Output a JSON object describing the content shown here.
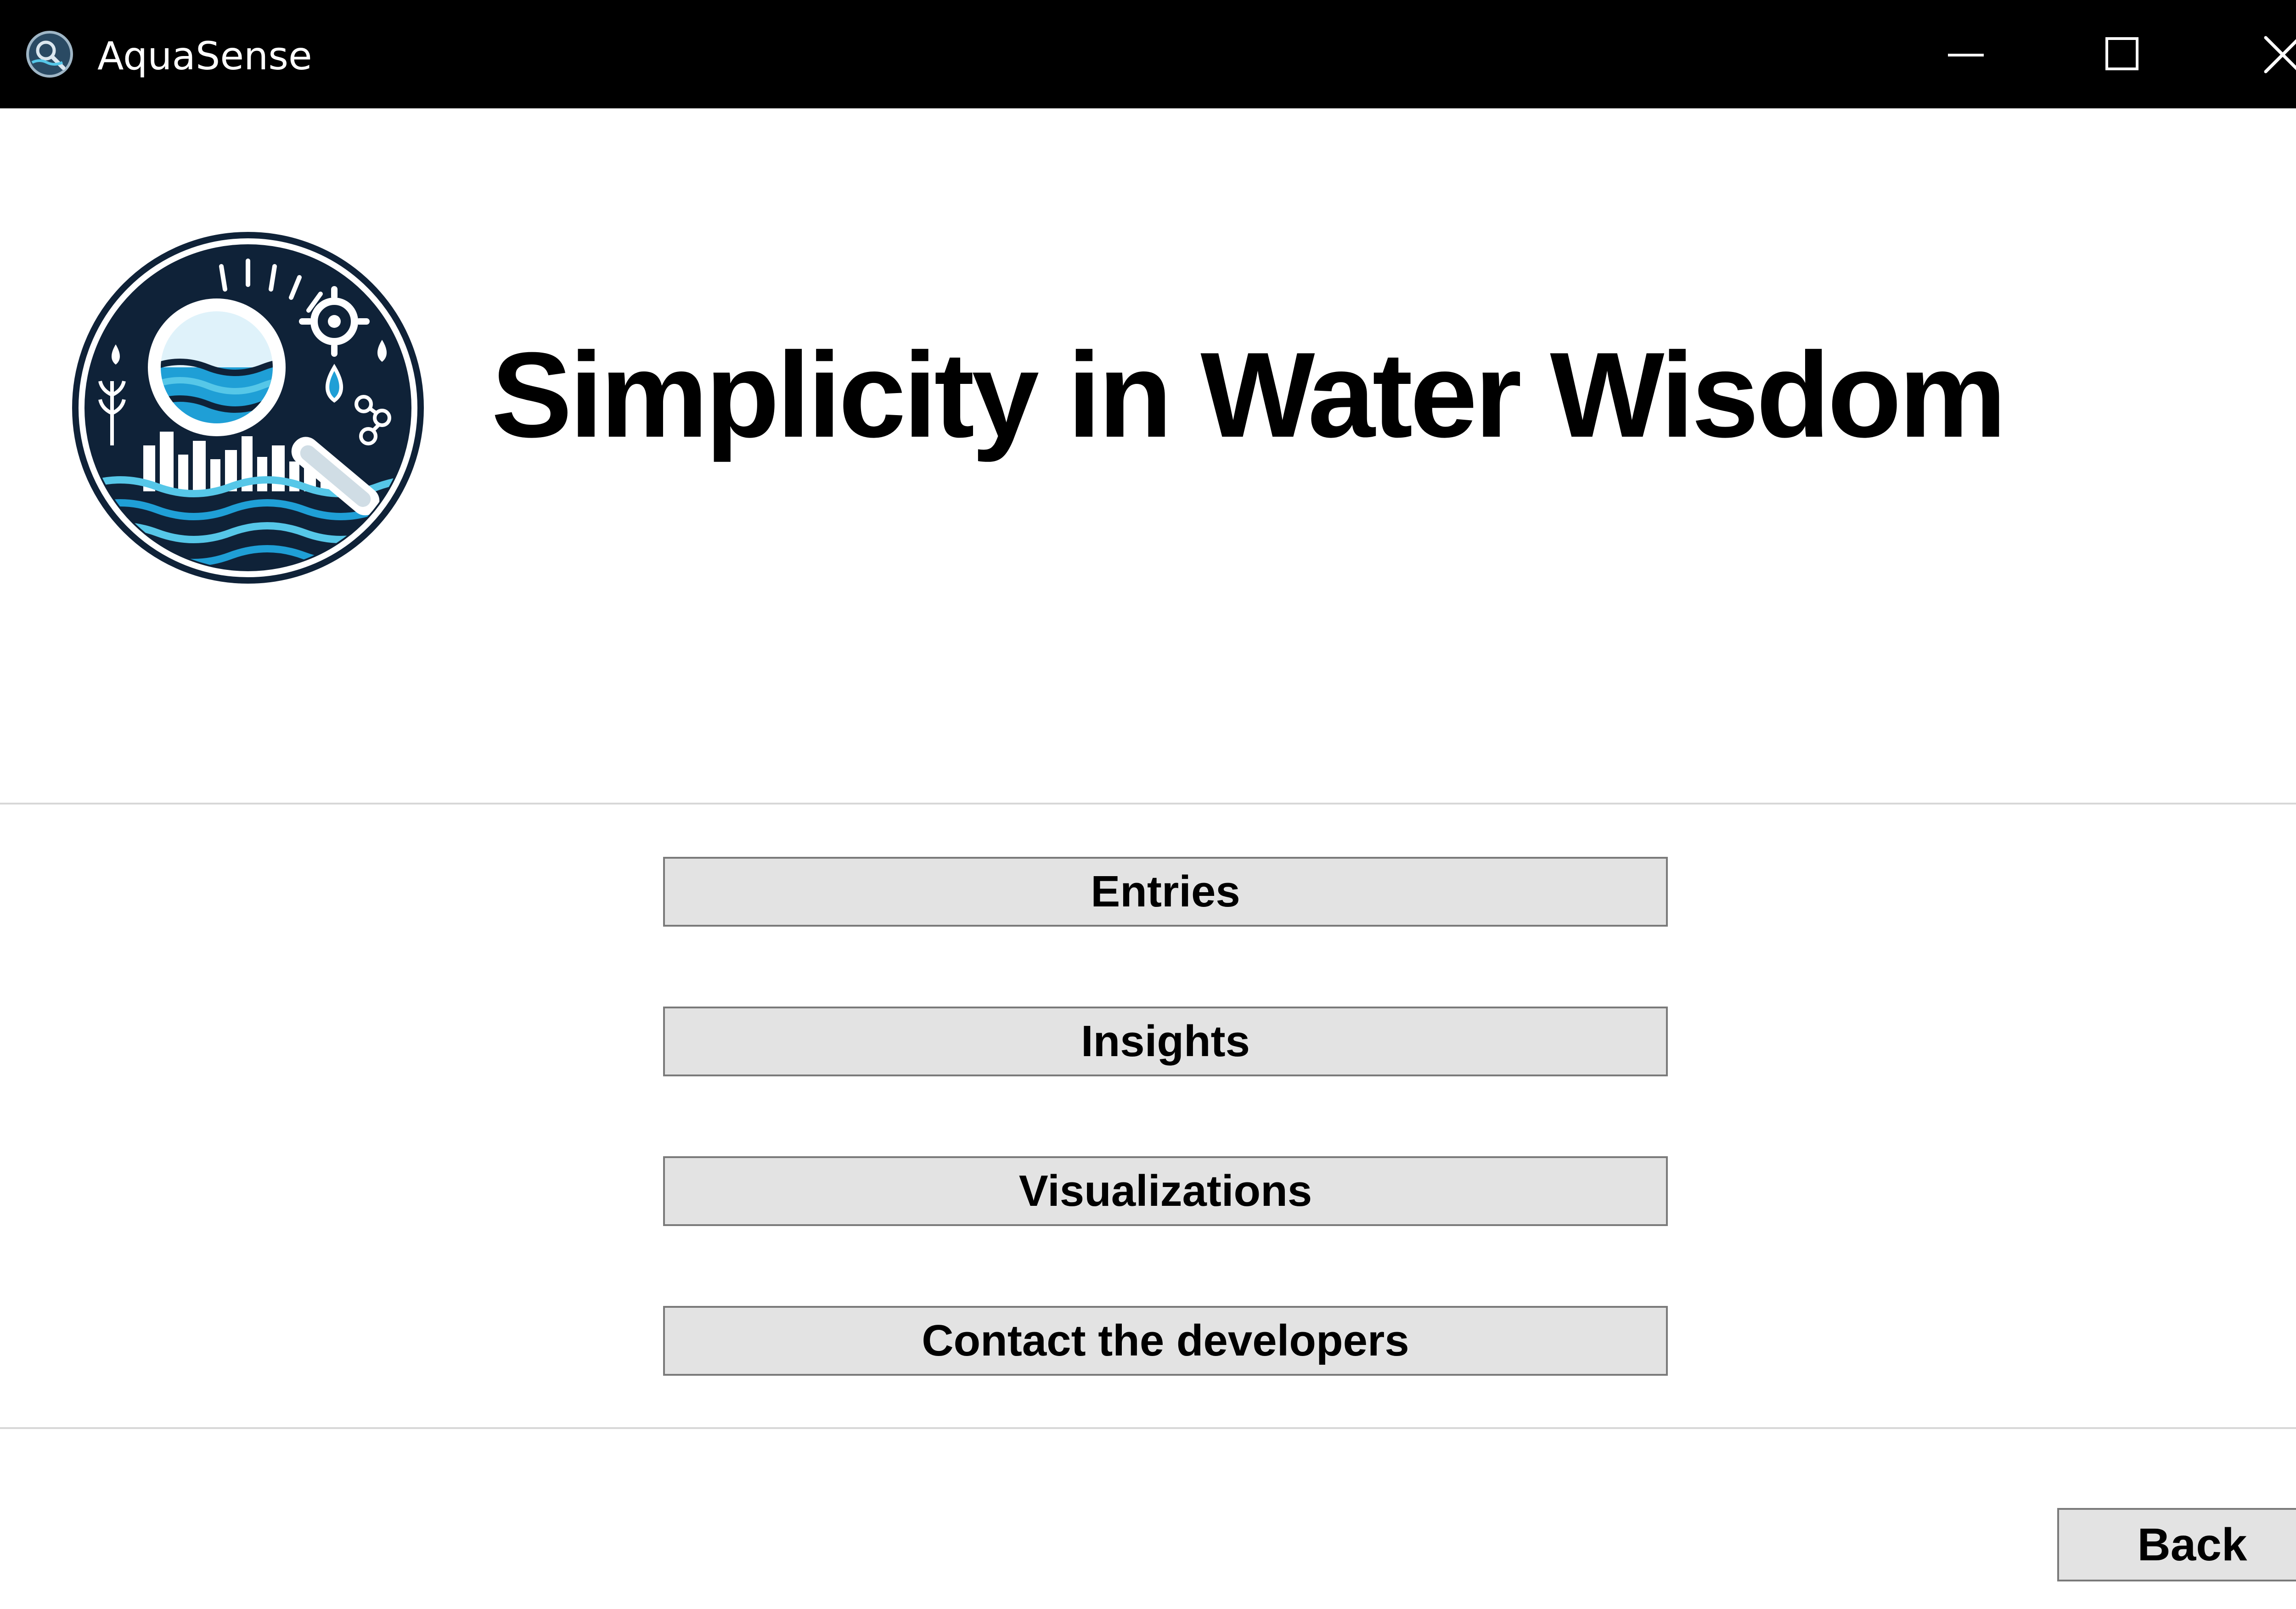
{
  "window": {
    "title": "AquaSense",
    "app_icon": "aquasense-app-icon",
    "controls": {
      "minimize_icon": "minimize-icon",
      "maximize_icon": "maximize-icon",
      "close_icon": "close-icon"
    }
  },
  "header": {
    "logo_icon": "aquasense-logo",
    "headline": "Simplicity in Water Wisdom"
  },
  "menu": {
    "entries_label": "Entries",
    "insights_label": "Insights",
    "visualizations_label": "Visualizations",
    "contact_label": "Contact the developers"
  },
  "footer": {
    "back_label": "Back"
  },
  "colors": {
    "titlebar": "#000000",
    "button_face": "#e3e3e3",
    "button_border": "#7a7a7a",
    "logo_navy": "#0f2238",
    "logo_blue": "#1f9fd6",
    "logo_cyan": "#56c7e8"
  }
}
